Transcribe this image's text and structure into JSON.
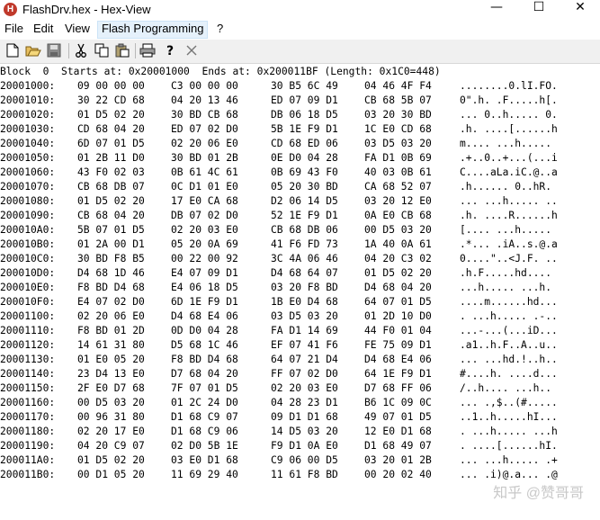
{
  "window": {
    "title": "FlashDrv.hex - Hex-View",
    "icon_letter": "H",
    "controls": {
      "minimize": "—",
      "maximize": "☐",
      "close": "✕"
    }
  },
  "menu": [
    {
      "label": "File"
    },
    {
      "label": "Edit"
    },
    {
      "label": "View"
    },
    {
      "label": "Flash Programming",
      "active": true
    },
    {
      "label": "?"
    }
  ],
  "toolbar": {
    "icons": [
      "new-file-icon",
      "open-folder-icon",
      "save-disk-icon",
      "cut-scissors-icon",
      "copy-icon",
      "paste-icon",
      "print-icon",
      "help-icon",
      "close-x-icon"
    ]
  },
  "block_header": "Block  0  Starts at: 0x20001000  Ends at: 0x200011BF (Length: 0x1C0=448)",
  "rows": [
    {
      "addr": "20001000:",
      "g1": "09 00 00 00",
      "g2": "C3 00 00 00",
      "g3": "30 B5 6C 49",
      "g4": "04 46 4F F4",
      "ascii": "........0.lI.FO."
    },
    {
      "addr": "20001010:",
      "g1": "30 22 CD 68",
      "g2": "04 20 13 46",
      "g3": "ED 07 09 D1",
      "g4": "CB 68 5B 07",
      "ascii": "0\".h. .F.....h[."
    },
    {
      "addr": "20001020:",
      "g1": "01 D5 02 20",
      "g2": "30 BD CB 68",
      "g3": "DB 06 18 D5",
      "g4": "03 20 30 BD",
      "ascii": "... 0..h..... 0."
    },
    {
      "addr": "20001030:",
      "g1": "CD 68 04 20",
      "g2": "ED 07 02 D0",
      "g3": "5B 1E F9 D1",
      "g4": "1C E0 CD 68",
      "ascii": ".h. ....[......h"
    },
    {
      "addr": "20001040:",
      "g1": "6D 07 01 D5",
      "g2": "02 20 06 E0",
      "g3": "CD 68 ED 06",
      "g4": "03 D5 03 20",
      "ascii": "m.... ...h..... "
    },
    {
      "addr": "20001050:",
      "g1": "01 2B 11 D0",
      "g2": "30 BD 01 2B",
      "g3": "0E D0 04 28",
      "g4": "FA D1 0B 69",
      "ascii": ".+..0..+...(...i"
    },
    {
      "addr": "20001060:",
      "g1": "43 F0 02 03",
      "g2": "0B 61 4C 61",
      "g3": "0B 69 43 F0",
      "g4": "40 03 0B 61",
      "ascii": "C....aLa.iC.@..a"
    },
    {
      "addr": "20001070:",
      "g1": "CB 68 DB 07",
      "g2": "0C D1 01 E0",
      "g3": "05 20 30 BD",
      "g4": "CA 68 52 07",
      "ascii": ".h...... 0..hR."
    },
    {
      "addr": "20001080:",
      "g1": "01 D5 02 20",
      "g2": "17 E0 CA 68",
      "g3": "D2 06 14 D5",
      "g4": "03 20 12 E0",
      "ascii": "... ...h..... .."
    },
    {
      "addr": "20001090:",
      "g1": "CB 68 04 20",
      "g2": "DB 07 02 D0",
      "g3": "52 1E F9 D1",
      "g4": "0A E0 CB 68",
      "ascii": ".h. ....R......h"
    },
    {
      "addr": "200010A0:",
      "g1": "5B 07 01 D5",
      "g2": "02 20 03 E0",
      "g3": "CB 68 DB 06",
      "g4": "00 D5 03 20",
      "ascii": "[.... ...h..... "
    },
    {
      "addr": "200010B0:",
      "g1": "01 2A 00 D1",
      "g2": "05 20 0A 69",
      "g3": "41 F6 FD 73",
      "g4": "1A 40 0A 61",
      "ascii": ".*... .iA..s.@.a"
    },
    {
      "addr": "200010C0:",
      "g1": "30 BD F8 B5",
      "g2": "00 22 00 92",
      "g3": "3C 4A 06 46",
      "g4": "04 20 C3 02",
      "ascii": "0....\"..<J.F. .."
    },
    {
      "addr": "200010D0:",
      "g1": "D4 68 1D 46",
      "g2": "E4 07 09 D1",
      "g3": "D4 68 64 07",
      "g4": "01 D5 02 20",
      "ascii": ".h.F.....hd.... "
    },
    {
      "addr": "200010E0:",
      "g1": "F8 BD D4 68",
      "g2": "E4 06 18 D5",
      "g3": "03 20 F8 BD",
      "g4": "D4 68 04 20",
      "ascii": "...h..... ...h. "
    },
    {
      "addr": "200010F0:",
      "g1": "E4 07 02 D0",
      "g2": "6D 1E F9 D1",
      "g3": "1B E0 D4 68",
      "g4": "64 07 01 D5",
      "ascii": "....m......hd..."
    },
    {
      "addr": "20001100:",
      "g1": "02 20 06 E0",
      "g2": "D4 68 E4 06",
      "g3": "03 D5 03 20",
      "g4": "01 2D 10 D0",
      "ascii": ". ...h..... .-.."
    },
    {
      "addr": "20001110:",
      "g1": "F8 BD 01 2D",
      "g2": "0D D0 04 28",
      "g3": "FA D1 14 69",
      "g4": "44 F0 01 04",
      "ascii": "...-...(...iD..."
    },
    {
      "addr": "20001120:",
      "g1": "14 61 31 80",
      "g2": "D5 68 1C 46",
      "g3": "EF 07 41 F6",
      "g4": "FE 75 09 D1",
      "ascii": ".a1..h.F..A..u.."
    },
    {
      "addr": "20001130:",
      "g1": "01 E0 05 20",
      "g2": "F8 BD D4 68",
      "g3": "64 07 21 D4",
      "g4": "D4 68 E4 06",
      "ascii": "... ...hd.!..h.."
    },
    {
      "addr": "20001140:",
      "g1": "23 D4 13 E0",
      "g2": "D7 68 04 20",
      "g3": "FF 07 02 D0",
      "g4": "64 1E F9 D1",
      "ascii": "#....h. ....d..."
    },
    {
      "addr": "20001150:",
      "g1": "2F E0 D7 68",
      "g2": "7F 07 01 D5",
      "g3": "02 20 03 E0",
      "g4": "D7 68 FF 06",
      "ascii": "/..h.... ...h.."
    },
    {
      "addr": "20001160:",
      "g1": "00 D5 03 20",
      "g2": "01 2C 24 D0",
      "g3": "04 28 23 D1",
      "g4": "B6 1C 09 0C",
      "ascii": "... .,$..(#....."
    },
    {
      "addr": "20001170:",
      "g1": "00 96 31 80",
      "g2": "D1 68 C9 07",
      "g3": "09 D1 D1 68",
      "g4": "49 07 01 D5",
      "ascii": "..1..h.....hI..."
    },
    {
      "addr": "20001180:",
      "g1": "02 20 17 E0",
      "g2": "D1 68 C9 06",
      "g3": "14 D5 03 20",
      "g4": "12 E0 D1 68",
      "ascii": ". ...h..... ...h"
    },
    {
      "addr": "20001190:",
      "g1": "04 20 C9 07",
      "g2": "02 D0 5B 1E",
      "g3": "F9 D1 0A E0",
      "g4": "D1 68 49 07",
      "ascii": ". ....[......hI."
    },
    {
      "addr": "200011A0:",
      "g1": "01 D5 02 20",
      "g2": "03 E0 D1 68",
      "g3": "C9 06 00 D5",
      "g4": "03 20 01 2B",
      "ascii": "... ...h..... .+"
    },
    {
      "addr": "200011B0:",
      "g1": "00 D1 05 20",
      "g2": "11 69 29 40",
      "g3": "11 61 F8 BD",
      "g4": "00 20 02 40",
      "ascii": "... .i)@.a... .@"
    }
  ],
  "watermark": "知乎 @赞哥哥"
}
